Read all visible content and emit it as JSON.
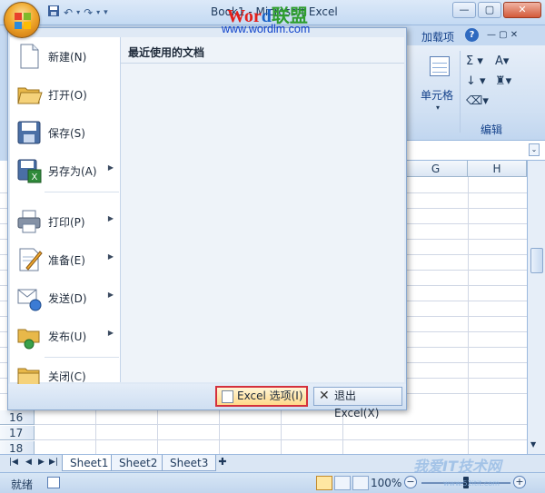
{
  "window": {
    "title": "Book1 - Microsoft Excel",
    "controls": [
      "—",
      "▢",
      "✕"
    ]
  },
  "watermark": {
    "brand_part1": "Wor",
    "brand_part2": "d",
    "brand_part3": "联盟",
    "url": "www.wordlm.com",
    "bottom_brand": "我爱IT技术网",
    "bottom_url": "www.52itit.com"
  },
  "ribbon": {
    "addins_tab": "加载项",
    "help": "?",
    "cells_group_button": "单元格",
    "editing_group_label": "编辑",
    "editing_icons": [
      "Σ",
      "A",
      "↓"
    ]
  },
  "office_menu": {
    "items": [
      {
        "label": "新建(N)",
        "icon": "new-document-icon",
        "submenu": false
      },
      {
        "label": "打开(O)",
        "icon": "open-folder-icon",
        "submenu": false
      },
      {
        "label": "保存(S)",
        "icon": "save-disk-icon",
        "submenu": false
      },
      {
        "label": "另存为(A)",
        "icon": "save-as-icon",
        "submenu": true
      },
      {
        "label": "打印(P)",
        "icon": "printer-icon",
        "submenu": true
      },
      {
        "label": "准备(E)",
        "icon": "prepare-document-icon",
        "submenu": true
      },
      {
        "label": "发送(D)",
        "icon": "send-icon",
        "submenu": true
      },
      {
        "label": "发布(U)",
        "icon": "publish-icon",
        "submenu": true
      },
      {
        "label": "关闭(C)",
        "icon": "close-folder-icon",
        "submenu": false
      }
    ],
    "recent_title": "最近使用的文档",
    "options_button": "Excel 选项(I)",
    "exit_button": "退出 Excel(X)"
  },
  "grid": {
    "column_headers": [
      "G",
      "H"
    ],
    "row_headers": [
      "16",
      "17",
      "18"
    ]
  },
  "sheets": {
    "tabs": [
      "Sheet1",
      "Sheet2",
      "Sheet3"
    ],
    "active": "Sheet1"
  },
  "status": {
    "ready": "就绪",
    "zoom": "100%",
    "zoom_fraction": 0.5
  },
  "colors": {
    "highlight_border": "#d4303c",
    "ribbon_blue": "#c5d9f1"
  }
}
